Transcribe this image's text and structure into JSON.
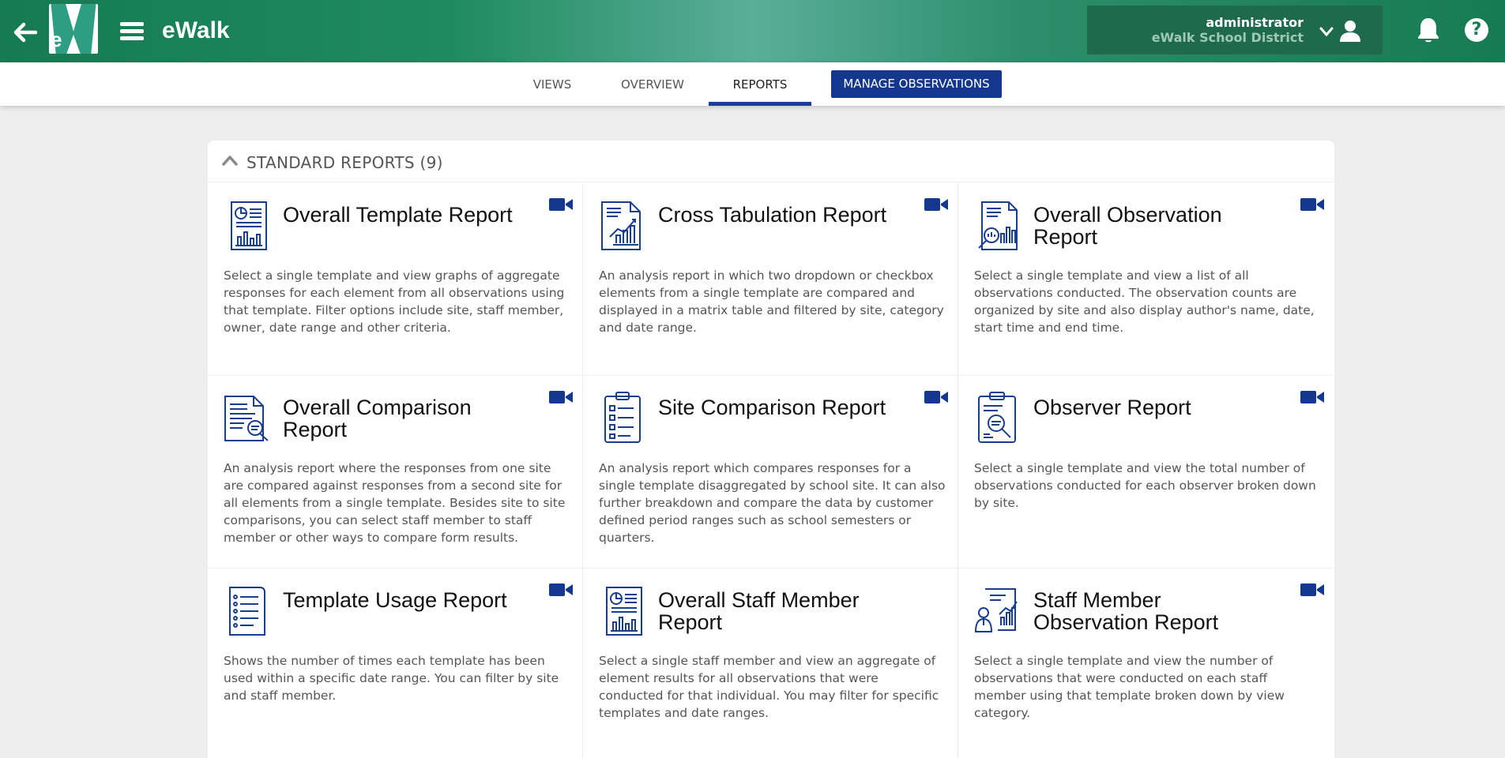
{
  "header": {
    "app_title": "eWalk",
    "logo_letters": "eW",
    "user": {
      "name": "administrator",
      "organization": "eWalk School District"
    }
  },
  "tabs": [
    {
      "label": "VIEWS",
      "active": false
    },
    {
      "label": "OVERVIEW",
      "active": false
    },
    {
      "label": "REPORTS",
      "active": true
    }
  ],
  "manage_button": "MANAGE OBSERVATIONS",
  "section": {
    "title": "STANDARD REPORTS (9)"
  },
  "reports": [
    {
      "title": "Overall Template Report",
      "icon": "report-chart-icon",
      "description": "Select a single template and view graphs of aggregate responses for each element from all observations using that template. Filter options include site, staff member, owner, date range and other criteria."
    },
    {
      "title": "Cross Tabulation Report",
      "icon": "cross-tabulation-icon",
      "description": "An analysis report in which two dropdown or checkbox elements from a single template are compared and displayed in a matrix table and filtered by site, category and date range."
    },
    {
      "title": "Overall Observation Report",
      "icon": "observation-magnifier-icon",
      "description": "Select a single template and view a list of all observations conducted. The observation counts are organized by site and also display author's name, date, start time and end time."
    },
    {
      "title": "Overall Comparison Report",
      "icon": "comparison-magnifier-icon",
      "description": "An analysis report where the responses from one site are compared against responses from a second site for all elements from a single template. Besides site to site comparisons, you can select staff member to staff member or other ways to compare form results."
    },
    {
      "title": "Site Comparison Report",
      "icon": "clipboard-checklist-icon",
      "description": "An analysis report which compares responses for a single template disaggregated by school site. It can also further breakdown and compare the data by customer defined period ranges such as school semesters or quarters."
    },
    {
      "title": "Observer Report",
      "icon": "clipboard-magnifier-icon",
      "description": "Select a single template and view the total number of observations conducted for each observer broken down by site."
    },
    {
      "title": "Template Usage Report",
      "icon": "list-document-icon",
      "description": "Shows the number of times each template has been used within a specific date range. You can filter by site and staff member."
    },
    {
      "title": "Overall Staff Member Report",
      "icon": "staff-report-icon",
      "description": "Select a single staff member and view an aggregate of element results for all observations that were conducted for that individual. You may filter for specific templates and date ranges."
    },
    {
      "title": "Staff Member Observation Report",
      "icon": "staff-observation-icon",
      "description": "Select a single template and view the number of observations that were conducted on each staff member using that template broken down by view category."
    }
  ],
  "colors": {
    "brand_green": "#167a52",
    "accent_blue": "#14378f",
    "icon_blue": "#1a3e8f"
  }
}
